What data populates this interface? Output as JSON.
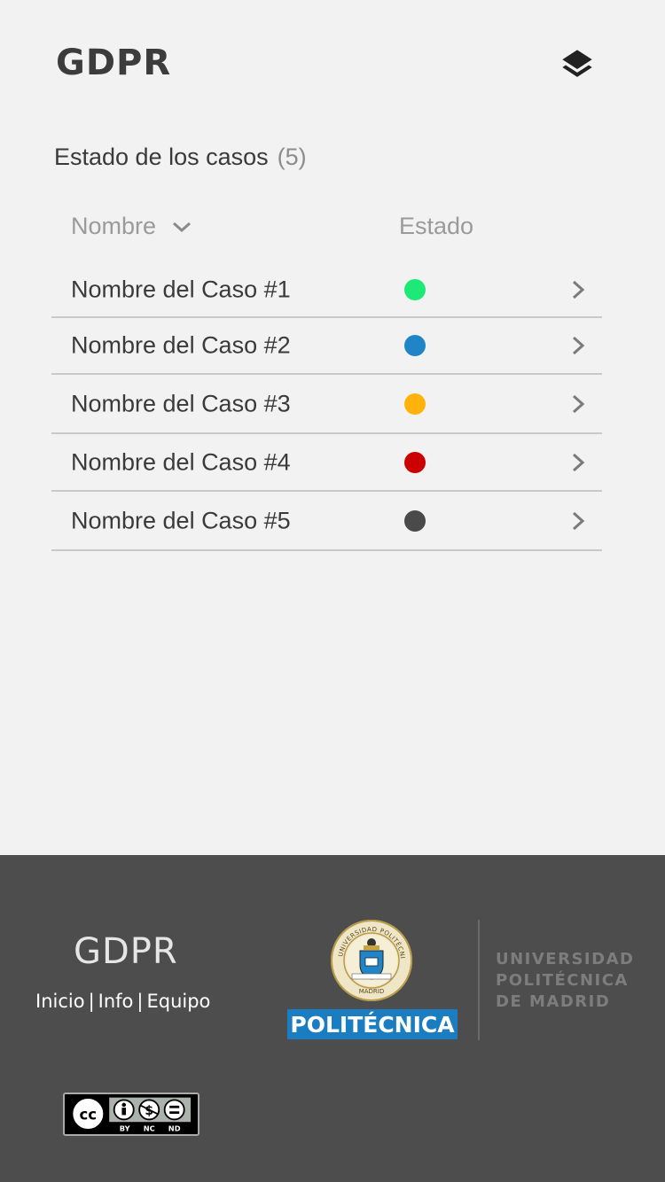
{
  "header": {
    "title": "GDPR",
    "layers_icon": "layers-icon"
  },
  "section": {
    "title": "Estado de los casos",
    "count": "(5)"
  },
  "table": {
    "columns": {
      "name": "Nombre",
      "status": "Estado"
    },
    "sort_icon": "chevron-down-icon",
    "rows": [
      {
        "name": "Nombre del Caso #1",
        "status_color": "#1de977"
      },
      {
        "name": "Nombre del Caso #2",
        "status_color": "#1f85c6"
      },
      {
        "name": "Nombre del Caso #3",
        "status_color": "#ffb20c"
      },
      {
        "name": "Nombre del Caso #4",
        "status_color": "#cc0000"
      },
      {
        "name": "Nombre del Caso #5",
        "status_color": "#4a4a4a"
      }
    ],
    "row_icon": "chevron-right-icon"
  },
  "footer": {
    "title": "GDPR",
    "links": [
      "Inicio",
      "Info",
      "Equipo"
    ],
    "separator": "|",
    "badge": "POLITÉCNICA",
    "university": [
      "UNIVERSIDAD",
      "POLITÉCNICA",
      "DE MADRID"
    ],
    "seal_text": "UNIVERSIDAD POLITÉCNICA · MADRID",
    "license_labels": [
      "BY",
      "NC",
      "ND"
    ]
  },
  "colors": {
    "background": "#f2f2f2",
    "footer_background": "#4d4d4d",
    "upm_blue": "#1a7dc1"
  }
}
